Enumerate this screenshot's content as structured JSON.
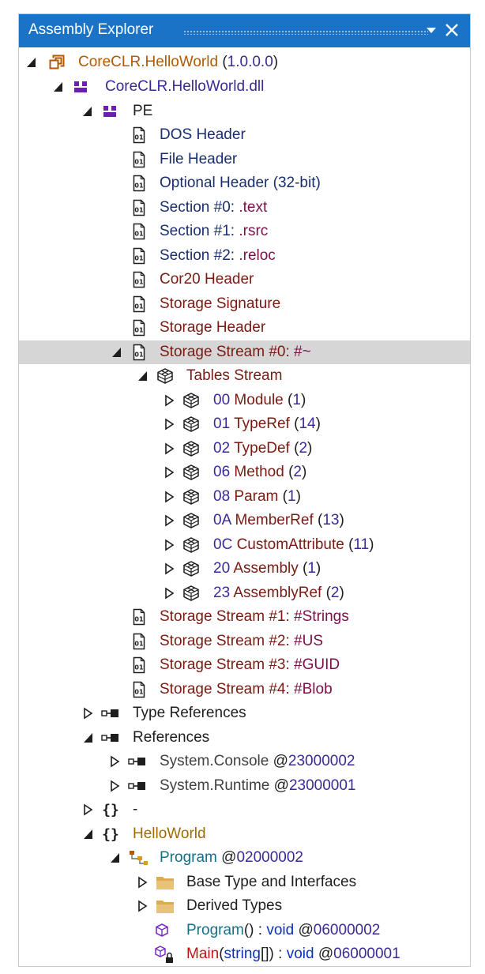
{
  "window": {
    "title": "Assembly Explorer"
  },
  "rows": [
    {
      "toggle": "expanded",
      "icon": "assembly",
      "parts": [
        {
          "text": "CoreCLR.HelloWorld",
          "color": "orange"
        },
        {
          "text": " (",
          "color": "dark"
        },
        {
          "text": "1.0.0.0",
          "color": "purple"
        },
        {
          "text": ")",
          "color": "dark"
        }
      ]
    },
    {
      "toggle": "expanded",
      "icon": "module",
      "parts": [
        {
          "text": "CoreCLR.HelloWorld.dll",
          "color": "purple"
        }
      ]
    },
    {
      "toggle": "expanded",
      "icon": "module",
      "parts": [
        {
          "text": "PE",
          "color": "dark"
        }
      ]
    },
    {
      "icon": "binary-file",
      "parts": [
        {
          "text": "DOS Header",
          "color": "navy"
        }
      ]
    },
    {
      "icon": "binary-file",
      "parts": [
        {
          "text": "File Header",
          "color": "navy"
        }
      ]
    },
    {
      "icon": "binary-file",
      "parts": [
        {
          "text": "Optional Header (32-bit)",
          "color": "navy"
        }
      ]
    },
    {
      "icon": "binary-file",
      "parts": [
        {
          "text": "Section #0: ",
          "color": "navy"
        },
        {
          "text": ".text",
          "color": "mag"
        }
      ]
    },
    {
      "icon": "binary-file",
      "parts": [
        {
          "text": "Section #1: ",
          "color": "navy"
        },
        {
          "text": ".rsrc",
          "color": "mag"
        }
      ]
    },
    {
      "icon": "binary-file",
      "parts": [
        {
          "text": "Section #2: ",
          "color": "navy"
        },
        {
          "text": ".reloc",
          "color": "mag"
        }
      ]
    },
    {
      "icon": "binary-file",
      "parts": [
        {
          "text": "Cor20 Header",
          "color": "maroon"
        }
      ]
    },
    {
      "icon": "binary-file",
      "parts": [
        {
          "text": "Storage Signature",
          "color": "maroon"
        }
      ]
    },
    {
      "icon": "binary-file",
      "parts": [
        {
          "text": "Storage Header",
          "color": "maroon"
        }
      ]
    },
    {
      "toggle": "expanded",
      "icon": "binary-file",
      "selected": true,
      "parts": [
        {
          "text": "Storage Stream #0: ",
          "color": "maroon"
        },
        {
          "text": "#~",
          "color": "mag"
        }
      ]
    },
    {
      "toggle": "expanded",
      "icon": "table",
      "parts": [
        {
          "text": "Tables Stream",
          "color": "maroon"
        }
      ]
    },
    {
      "toggle": "collapsed",
      "icon": "table",
      "parts": [
        {
          "text": "00 ",
          "color": "purple"
        },
        {
          "text": "Module",
          "color": "maroon"
        },
        {
          "text": " (",
          "color": "dark"
        },
        {
          "text": "1",
          "color": "purple"
        },
        {
          "text": ")",
          "color": "dark"
        }
      ]
    },
    {
      "toggle": "collapsed",
      "icon": "table",
      "parts": [
        {
          "text": "01 ",
          "color": "purple"
        },
        {
          "text": "TypeRef",
          "color": "maroon"
        },
        {
          "text": " (",
          "color": "dark"
        },
        {
          "text": "14",
          "color": "purple"
        },
        {
          "text": ")",
          "color": "dark"
        }
      ]
    },
    {
      "toggle": "collapsed",
      "icon": "table",
      "parts": [
        {
          "text": "02 ",
          "color": "purple"
        },
        {
          "text": "TypeDef",
          "color": "maroon"
        },
        {
          "text": " (",
          "color": "dark"
        },
        {
          "text": "2",
          "color": "purple"
        },
        {
          "text": ")",
          "color": "dark"
        }
      ]
    },
    {
      "toggle": "collapsed",
      "icon": "table",
      "parts": [
        {
          "text": "06 ",
          "color": "purple"
        },
        {
          "text": "Method",
          "color": "maroon"
        },
        {
          "text": " (",
          "color": "dark"
        },
        {
          "text": "2",
          "color": "purple"
        },
        {
          "text": ")",
          "color": "dark"
        }
      ]
    },
    {
      "toggle": "collapsed",
      "icon": "table",
      "parts": [
        {
          "text": "08 ",
          "color": "purple"
        },
        {
          "text": "Param",
          "color": "maroon"
        },
        {
          "text": " (",
          "color": "dark"
        },
        {
          "text": "1",
          "color": "purple"
        },
        {
          "text": ")",
          "color": "dark"
        }
      ]
    },
    {
      "toggle": "collapsed",
      "icon": "table",
      "parts": [
        {
          "text": "0A ",
          "color": "purple"
        },
        {
          "text": "MemberRef",
          "color": "maroon"
        },
        {
          "text": " (",
          "color": "dark"
        },
        {
          "text": "13",
          "color": "purple"
        },
        {
          "text": ")",
          "color": "dark"
        }
      ]
    },
    {
      "toggle": "collapsed",
      "icon": "table",
      "parts": [
        {
          "text": "0C ",
          "color": "purple"
        },
        {
          "text": "CustomAttribute",
          "color": "maroon"
        },
        {
          "text": " (",
          "color": "dark"
        },
        {
          "text": "11",
          "color": "purple"
        },
        {
          "text": ")",
          "color": "dark"
        }
      ]
    },
    {
      "toggle": "collapsed",
      "icon": "table",
      "parts": [
        {
          "text": "20 ",
          "color": "purple"
        },
        {
          "text": "Assembly",
          "color": "maroon"
        },
        {
          "text": " (",
          "color": "dark"
        },
        {
          "text": "1",
          "color": "purple"
        },
        {
          "text": ")",
          "color": "dark"
        }
      ]
    },
    {
      "toggle": "collapsed",
      "icon": "table",
      "parts": [
        {
          "text": "23 ",
          "color": "purple"
        },
        {
          "text": "AssemblyRef",
          "color": "maroon"
        },
        {
          "text": " (",
          "color": "dark"
        },
        {
          "text": "2",
          "color": "purple"
        },
        {
          "text": ")",
          "color": "dark"
        }
      ]
    },
    {
      "icon": "binary-file",
      "parts": [
        {
          "text": "Storage Stream #1: ",
          "color": "maroon"
        },
        {
          "text": "#Strings",
          "color": "mag"
        }
      ]
    },
    {
      "icon": "binary-file",
      "parts": [
        {
          "text": "Storage Stream #2: ",
          "color": "maroon"
        },
        {
          "text": "#US",
          "color": "mag"
        }
      ]
    },
    {
      "icon": "binary-file",
      "parts": [
        {
          "text": "Storage Stream #3: ",
          "color": "maroon"
        },
        {
          "text": "#GUID",
          "color": "mag"
        }
      ]
    },
    {
      "icon": "binary-file",
      "parts": [
        {
          "text": "Storage Stream #4: ",
          "color": "maroon"
        },
        {
          "text": "#Blob",
          "color": "mag"
        }
      ]
    },
    {
      "toggle": "collapsed",
      "icon": "reference",
      "parts": [
        {
          "text": "Type References",
          "color": "dark"
        }
      ]
    },
    {
      "toggle": "expanded",
      "icon": "reference",
      "parts": [
        {
          "text": "References",
          "color": "dark"
        }
      ]
    },
    {
      "toggle": "collapsed",
      "icon": "reference",
      "parts": [
        {
          "text": "System.Console",
          "color": "gray"
        },
        {
          "text": " @",
          "color": "dark"
        },
        {
          "text": "23000002",
          "color": "purple"
        }
      ]
    },
    {
      "toggle": "collapsed",
      "icon": "reference",
      "parts": [
        {
          "text": "System.Runtime",
          "color": "gray"
        },
        {
          "text": " @",
          "color": "dark"
        },
        {
          "text": "23000001",
          "color": "purple"
        }
      ]
    },
    {
      "toggle": "collapsed",
      "icon": "namespace",
      "parts": [
        {
          "text": "-",
          "color": "dark"
        }
      ]
    },
    {
      "toggle": "expanded",
      "icon": "namespace",
      "parts": [
        {
          "text": "HelloWorld",
          "color": "gold"
        }
      ]
    },
    {
      "toggle": "expanded",
      "icon": "class",
      "parts": [
        {
          "text": "Program",
          "color": "teal"
        },
        {
          "text": " @",
          "color": "dark"
        },
        {
          "text": "02000002",
          "color": "purple"
        }
      ]
    },
    {
      "toggle": "collapsed",
      "icon": "folder",
      "parts": [
        {
          "text": "Base Type and Interfaces",
          "color": "dark"
        }
      ]
    },
    {
      "toggle": "collapsed",
      "icon": "folder",
      "parts": [
        {
          "text": "Derived Types",
          "color": "dark"
        }
      ]
    },
    {
      "icon": "method",
      "parts": [
        {
          "text": "Program",
          "color": "teal"
        },
        {
          "text": "() : ",
          "color": "dark"
        },
        {
          "text": "void",
          "color": "blue"
        },
        {
          "text": " @",
          "color": "dark"
        },
        {
          "text": "06000002",
          "color": "purple"
        }
      ]
    },
    {
      "icon": "private-method",
      "parts": [
        {
          "text": "Main",
          "color": "red"
        },
        {
          "text": "(",
          "color": "dark"
        },
        {
          "text": "string",
          "color": "blue"
        },
        {
          "text": "[]) : ",
          "color": "dark"
        },
        {
          "text": "void",
          "color": "blue"
        },
        {
          "text": " @",
          "color": "dark"
        },
        {
          "text": "06000001",
          "color": "purple"
        }
      ]
    }
  ]
}
